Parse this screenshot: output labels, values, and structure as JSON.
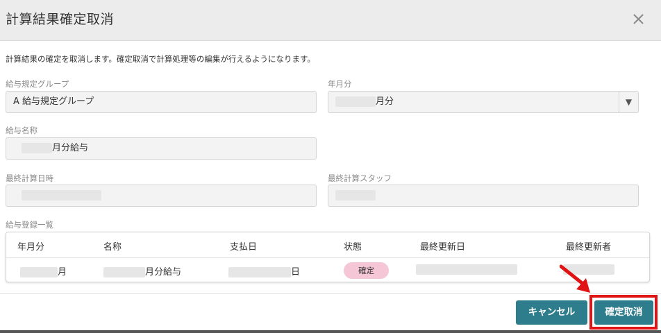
{
  "dialog": {
    "title": "計算結果確定取消",
    "description": "計算結果の確定を取消します。確定取消で計算処理等の編集が行えるようになります。"
  },
  "form": {
    "group_label": "給与規定グループ",
    "group_value": "A 給与規定グループ",
    "ym_label": "年月分",
    "ym_suffix": "月分",
    "name_label": "給与名称",
    "name_suffix": "月分給与",
    "last_calc_datetime_label": "最終計算日時",
    "last_calc_staff_label": "最終計算スタッフ"
  },
  "table": {
    "title": "給与登録一覧",
    "headers": [
      "年月分",
      "名称",
      "支払日",
      "状態",
      "最終更新日",
      "最終更新者"
    ],
    "rows": [
      {
        "ym_suffix": "月",
        "name_suffix": "月分給与",
        "paydate_suffix": "日",
        "status": "確定"
      }
    ]
  },
  "buttons": {
    "cancel": "キャンセル",
    "confirm_cancel": "確定取消"
  },
  "icons": {
    "close": "close-icon",
    "dropdown": "dropdown-arrow-icon",
    "pointer": "red-arrow-icon"
  },
  "colors": {
    "button": "#2e7d8c",
    "badge": "#f5c6d6",
    "highlight": "#e01414"
  }
}
